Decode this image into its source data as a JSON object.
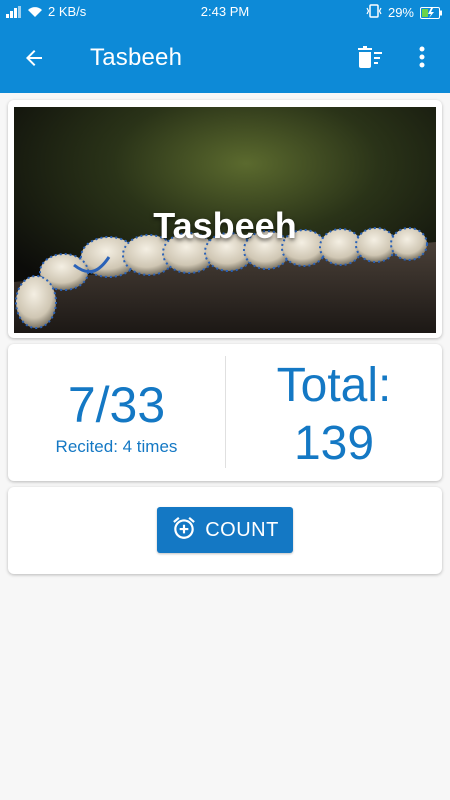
{
  "status_bar": {
    "network_speed": "2 KB/s",
    "time": "2:43 PM",
    "battery": "29%"
  },
  "app_bar": {
    "title": "Tasbeeh",
    "back_icon": "arrow-back-icon",
    "reset_icon": "delete-sweep-icon",
    "menu_icon": "more-vert-icon"
  },
  "hero": {
    "title": "Tasbeeh"
  },
  "counter": {
    "current": "7/33",
    "recited": "Recited: 4 times",
    "total_label": "Total:",
    "total_value": "139"
  },
  "action": {
    "count_label": "COUNT",
    "icon": "add-alarm-icon"
  },
  "colors": {
    "primary": "#0d8ad7",
    "accent": "#1478c4"
  }
}
